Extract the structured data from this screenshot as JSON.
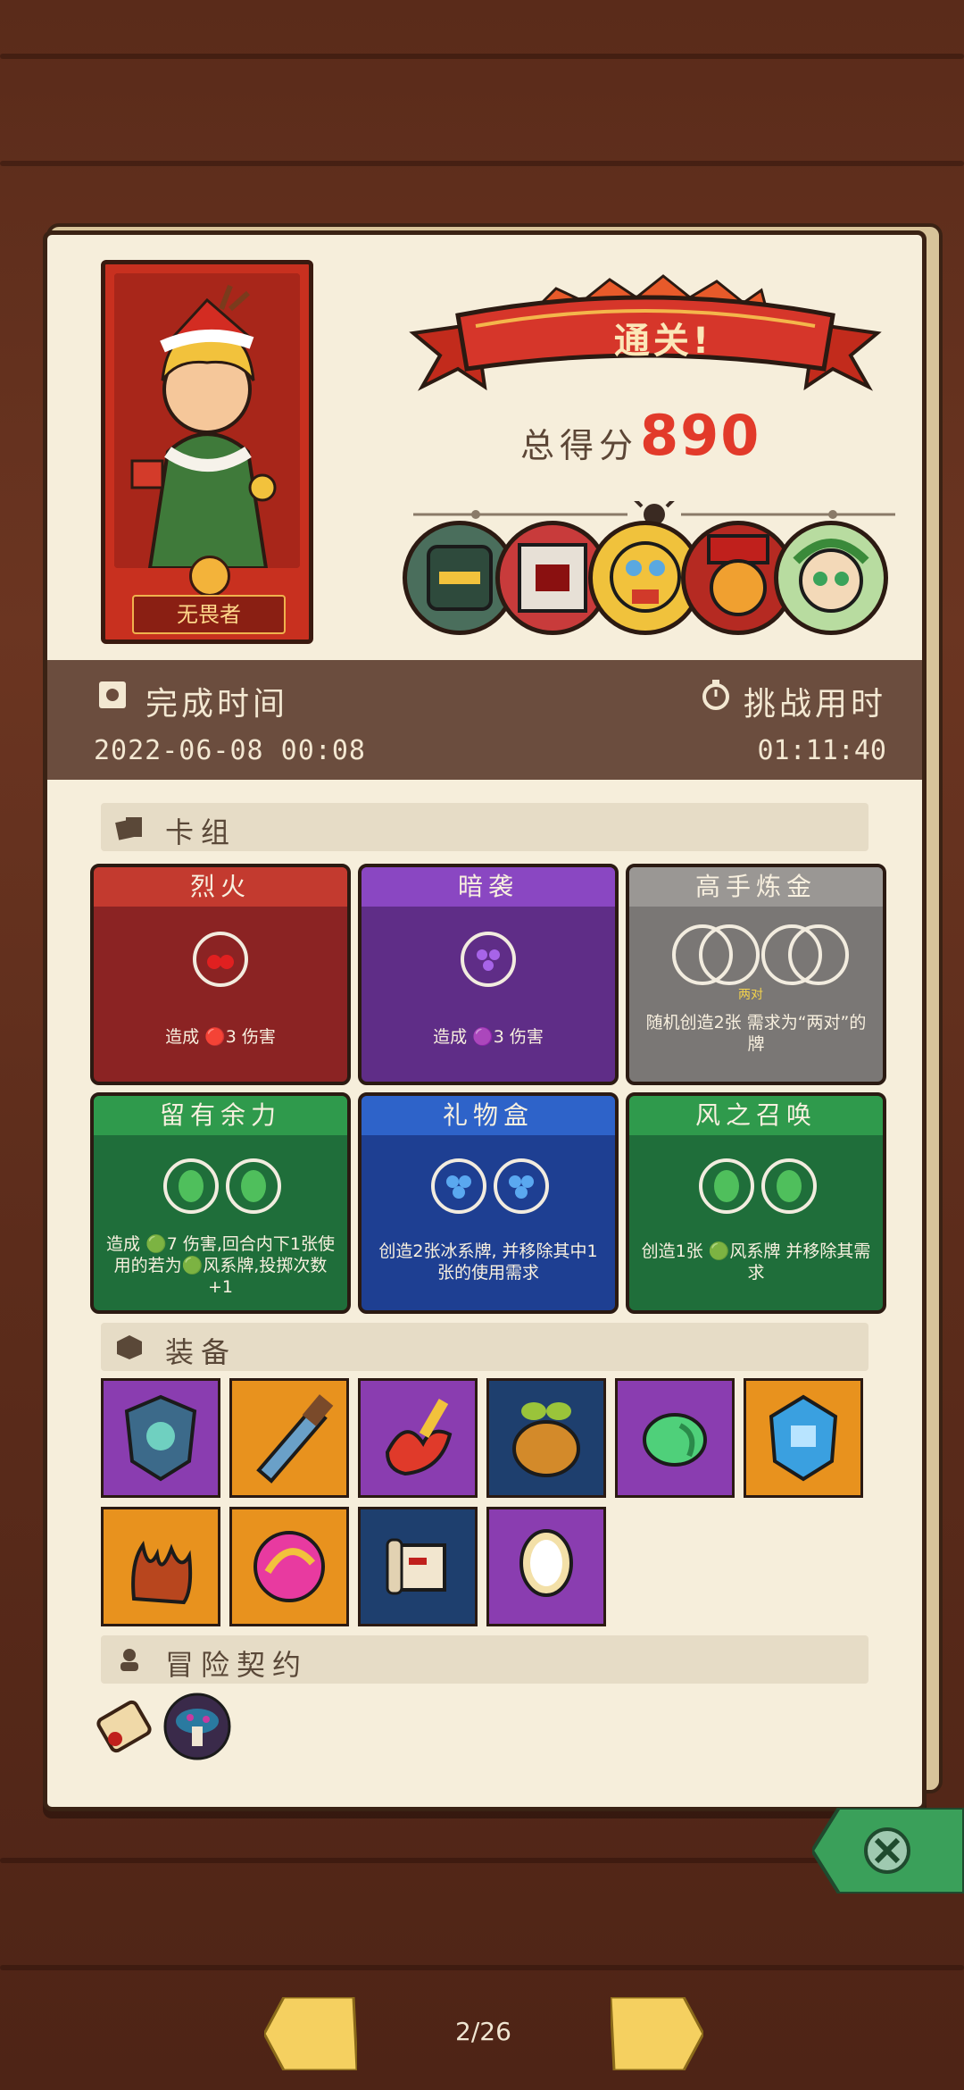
{
  "hero": {
    "name": "无畏者"
  },
  "result": {
    "title": "通关!",
    "score_label": "总得分",
    "score": "890"
  },
  "bosses": [
    "boss-1-icon",
    "boss-2-icon",
    "boss-3-icon",
    "boss-4-icon",
    "boss-5-icon"
  ],
  "time": {
    "completed_label": "完成时间",
    "completed_value": "2022-06-08 00:08",
    "challenge_label": "挑战用时",
    "challenge_value": "01:11:40"
  },
  "sections": {
    "deck": "卡组",
    "equipment": "装备",
    "contracts": "冒险契约"
  },
  "deck": [
    {
      "name": "烈火",
      "desc": "造成 🔴3 伤害",
      "color": "#8b2323",
      "header": "#c33a2f"
    },
    {
      "name": "暗袭",
      "desc": "造成 🟣3 伤害",
      "color": "#5f2d87",
      "header": "#8a47c2"
    },
    {
      "name": "高手炼金",
      "desc": "随机创造2张 需求为“两对”的牌",
      "note": "两对",
      "color": "#7a7775",
      "header": "#9a9794"
    },
    {
      "name": "留有余力",
      "desc": "造成 🟢7 伤害,回合内下1张使用的若为🟢风系牌,投掷次数+1",
      "color": "#1f6e3a",
      "header": "#2f9a4c"
    },
    {
      "name": "礼物盒",
      "desc": "创造2张冰系牌, 并移除其中1张的使用需求",
      "color": "#1e3f92",
      "header": "#2e63c9"
    },
    {
      "name": "风之召唤",
      "desc": "创造1张 🟢风系牌 并移除其需求",
      "color": "#1f6e3a",
      "header": "#2f9a4c"
    }
  ],
  "equipment": [
    "shield-relic-icon",
    "saw-blade-icon",
    "fire-dagger-icon",
    "honey-pot-icon",
    "green-wing-icon",
    "ice-crest-icon",
    "flame-claw-icon",
    "pink-orb-icon",
    "scroll-icon",
    "mirror-icon"
  ],
  "contracts": [
    "parchment-contract-icon",
    "mushroom-contract-icon"
  ],
  "pager": {
    "text": "2/26"
  },
  "colors": {
    "accent_red": "#e23a2a",
    "wood": "#5a2b1a",
    "paper": "#f6eedb"
  }
}
